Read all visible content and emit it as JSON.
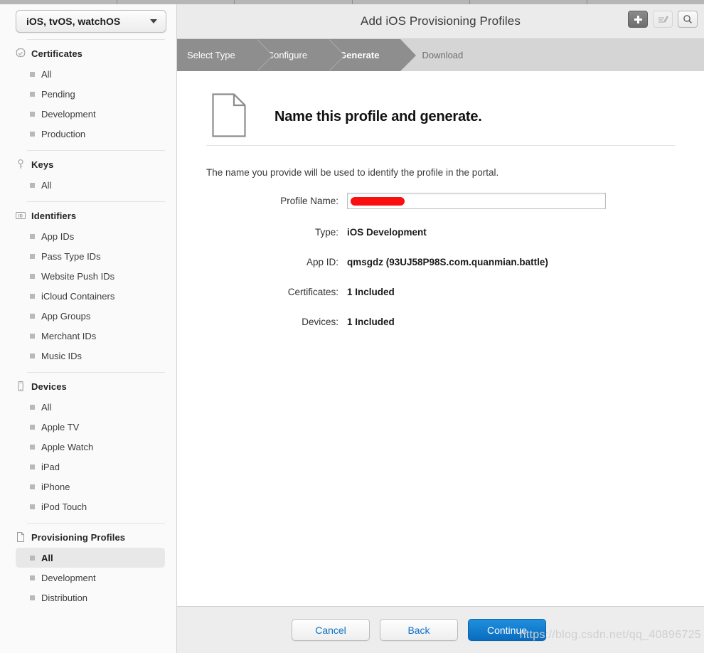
{
  "header": {
    "title": "Add iOS Provisioning Profiles",
    "tools": [
      {
        "name": "add-button",
        "icon": "plus-icon",
        "state": "active"
      },
      {
        "name": "edit-button",
        "icon": "pencil-edit-icon",
        "state": "disabled"
      },
      {
        "name": "search-button",
        "icon": "search-icon",
        "state": "normal"
      }
    ]
  },
  "sidebar": {
    "platform_selector": {
      "value": "iOS, tvOS, watchOS",
      "icon": "chevron-down-icon"
    },
    "sections": [
      {
        "title": "Certificates",
        "icon": "certificate-seal-icon",
        "items": [
          {
            "label": "All",
            "selected": false
          },
          {
            "label": "Pending",
            "selected": false
          },
          {
            "label": "Development",
            "selected": false
          },
          {
            "label": "Production",
            "selected": false
          }
        ]
      },
      {
        "title": "Keys",
        "icon": "key-icon",
        "items": [
          {
            "label": "All",
            "selected": false
          }
        ]
      },
      {
        "title": "Identifiers",
        "icon": "id-badge-icon",
        "items": [
          {
            "label": "App IDs",
            "selected": false
          },
          {
            "label": "Pass Type IDs",
            "selected": false
          },
          {
            "label": "Website Push IDs",
            "selected": false
          },
          {
            "label": "iCloud Containers",
            "selected": false
          },
          {
            "label": "App Groups",
            "selected": false
          },
          {
            "label": "Merchant IDs",
            "selected": false
          },
          {
            "label": "Music IDs",
            "selected": false
          }
        ]
      },
      {
        "title": "Devices",
        "icon": "phone-device-icon",
        "items": [
          {
            "label": "All",
            "selected": false
          },
          {
            "label": "Apple TV",
            "selected": false
          },
          {
            "label": "Apple Watch",
            "selected": false
          },
          {
            "label": "iPad",
            "selected": false
          },
          {
            "label": "iPhone",
            "selected": false
          },
          {
            "label": "iPod Touch",
            "selected": false
          }
        ]
      },
      {
        "title": "Provisioning Profiles",
        "icon": "document-page-icon",
        "items": [
          {
            "label": "All",
            "selected": true
          },
          {
            "label": "Development",
            "selected": false
          },
          {
            "label": "Distribution",
            "selected": false
          }
        ]
      }
    ]
  },
  "steps": [
    {
      "label": "Select Type",
      "state": "done"
    },
    {
      "label": "Configure",
      "state": "done"
    },
    {
      "label": "Generate",
      "state": "current"
    },
    {
      "label": "Download",
      "state": "upcoming"
    }
  ],
  "content": {
    "hero_icon": "document-page-icon",
    "hero_title": "Name this profile and generate.",
    "intro": "The name you provide will be used to identify the profile in the portal.",
    "fields": [
      {
        "label": "Profile Name:",
        "type": "input",
        "value": "",
        "placeholder": "",
        "redacted": true
      },
      {
        "label": "Type:",
        "type": "static",
        "value": "iOS Development"
      },
      {
        "label": "App ID:",
        "type": "static",
        "value": "qmsgdz (93UJ58P98S.com.quanmian.battle)"
      },
      {
        "label": "Certificates:",
        "type": "static",
        "value": "1 Included"
      },
      {
        "label": "Devices:",
        "type": "static",
        "value": "1 Included"
      }
    ]
  },
  "footer": {
    "buttons": [
      {
        "label": "Cancel",
        "style": "secondary"
      },
      {
        "label": "Back",
        "style": "secondary"
      },
      {
        "label": "Continue",
        "style": "primary"
      }
    ]
  },
  "watermark": "https://blog.csdn.net/qq_40896725",
  "colors": {
    "accent_blue": "#0b70c8",
    "primary_button": "#1f8fdd",
    "redaction_red": "#f90f0f",
    "sidebar_bg": "#fafafa",
    "step_done": "#8e8e8e",
    "step_track": "#d5d5d5"
  }
}
